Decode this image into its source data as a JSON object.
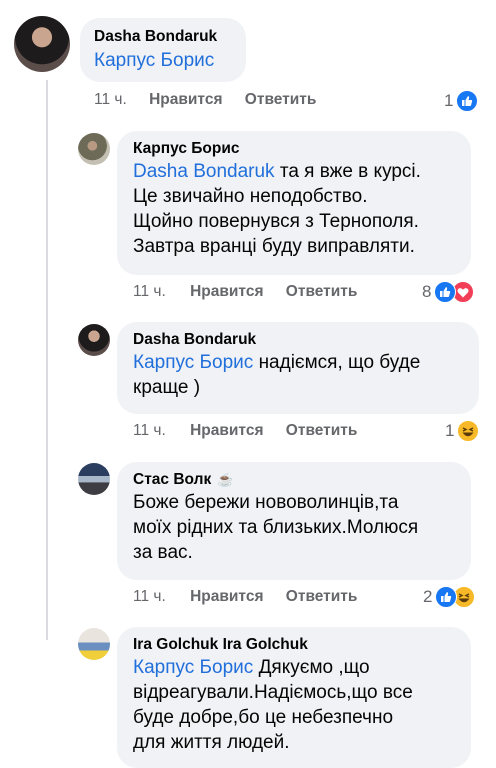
{
  "comments": [
    {
      "author": "Dasha Bondaruk",
      "mention": "Карпус Борис",
      "text": "",
      "time": "11 ч.",
      "like_label": "Нравится",
      "reply_label": "Ответить",
      "reaction_count": "1",
      "reactions": [
        "like"
      ]
    },
    {
      "author": "Карпус Борис",
      "mention": "Dasha Bondaruk",
      "text_lines": [
        "та я вже в курсі.",
        "Це звичайно неподобство.",
        "Щойно повернувся з Тернополя.",
        "Завтра вранці буду виправляти."
      ],
      "time": "11 ч.",
      "like_label": "Нравится",
      "reply_label": "Ответить",
      "reaction_count": "8",
      "reactions": [
        "like",
        "love"
      ]
    },
    {
      "author": "Dasha Bondaruk",
      "mention": "Карпус Борис",
      "text_lines": [
        "надіємся, що буде",
        "краще )"
      ],
      "time": "11 ч.",
      "like_label": "Нравится",
      "reply_label": "Ответить",
      "reaction_count": "1",
      "reactions": [
        "haha"
      ]
    },
    {
      "author": "Стас Волк",
      "author_badge": "coffee-cup",
      "text_lines": [
        "Боже бережи нововолинців,та",
        "моїх рідних та близьких.Молюся",
        "за вас."
      ],
      "time": "11 ч.",
      "like_label": "Нравится",
      "reply_label": "Ответить",
      "reaction_count": "2",
      "reactions": [
        "like",
        "haha"
      ]
    },
    {
      "author": "Ira Golchuk Ira Golchuk",
      "mention": "Карпус Борис",
      "text_lines": [
        "Дякуємо ,що",
        "відреагували.Надіємось,що все",
        "буде добре,бо це небезпечно",
        "для життя людей."
      ]
    }
  ],
  "colors": {
    "bubble": "#f0f2f5",
    "mention": "#216fdb",
    "meta": "#65676b",
    "like": "#1877f2",
    "love": "#f33e58",
    "haha": "#f7b928"
  }
}
